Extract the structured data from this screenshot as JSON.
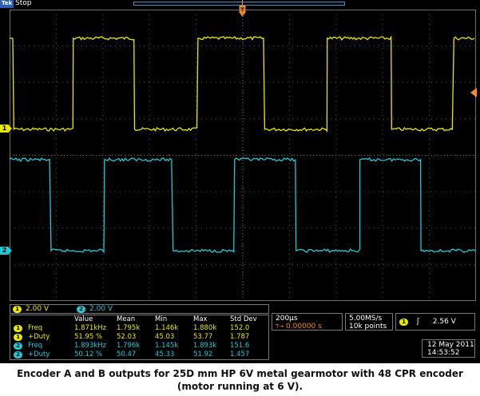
{
  "header": {
    "brand": "Tek",
    "run_state": "Stop"
  },
  "trigger_marker_label": "T",
  "chart_data": {
    "type": "line",
    "title": "",
    "x_units": "µs",
    "x_range_us": [
      -1000,
      1000
    ],
    "series": [
      {
        "channel": "1",
        "color": "#e8e800",
        "high_v": 5.0,
        "low_v": 0.0,
        "scale_v_per_div": 2.0,
        "edges_us": [
          -982,
          -727,
          -464,
          -192,
          94,
          362,
          638,
          905
        ],
        "initial_level": "high"
      },
      {
        "channel": "2",
        "color": "#22c8d6",
        "high_v": 5.0,
        "low_v": 0.0,
        "scale_v_per_div": 2.0,
        "edges_us": [
          -822,
          -593,
          -299,
          -35,
          228,
          502,
          764
        ],
        "initial_level": "high"
      }
    ]
  },
  "channel_scales": [
    {
      "ch": "1",
      "value": "2.00 V",
      "color": "#e8e800"
    },
    {
      "ch": "2",
      "value": "2.00 V",
      "color": "#22c8d6"
    }
  ],
  "measurements": {
    "headers": [
      "Value",
      "Mean",
      "Min",
      "Max",
      "Std Dev"
    ],
    "rows": [
      {
        "ch": "1",
        "label": "Freq",
        "value": "1.871kHz",
        "mean": "1.795k",
        "min": "1.146k",
        "max": "1.880k",
        "std": "152.0",
        "color": "#e8e800"
      },
      {
        "ch": "1",
        "label": "+Duty",
        "value": "51.95 %",
        "mean": "52.03",
        "min": "45.03",
        "max": "53.77",
        "std": "1.787",
        "color": "#e8e800"
      },
      {
        "ch": "2",
        "label": "Freq",
        "value": "1.893kHz",
        "mean": "1.796k",
        "min": "1.145k",
        "max": "1.893k",
        "std": "151.6",
        "color": "#22c8d6"
      },
      {
        "ch": "2",
        "label": "+Duty",
        "value": "50.12 %",
        "mean": "50.47",
        "min": "45.33",
        "max": "51.92",
        "std": "1.457",
        "color": "#22c8d6"
      }
    ]
  },
  "horizontal": {
    "timebase": "200µs",
    "delay": "0.00000 s",
    "delay_arrow": "T→"
  },
  "sampling": {
    "rate": "5.00MS/s",
    "points": "10k points"
  },
  "trigger": {
    "source": "1",
    "slope_symbol": "ʃ",
    "level": "2.56 V"
  },
  "datetime": {
    "date": "12 May 2011",
    "time": "14:53:52"
  },
  "caption": {
    "line1": "Encoder A and B outputs for 25D mm HP 6V metal gearmotor with 48 CPR encoder",
    "line2": "(motor running at 6 V)."
  }
}
